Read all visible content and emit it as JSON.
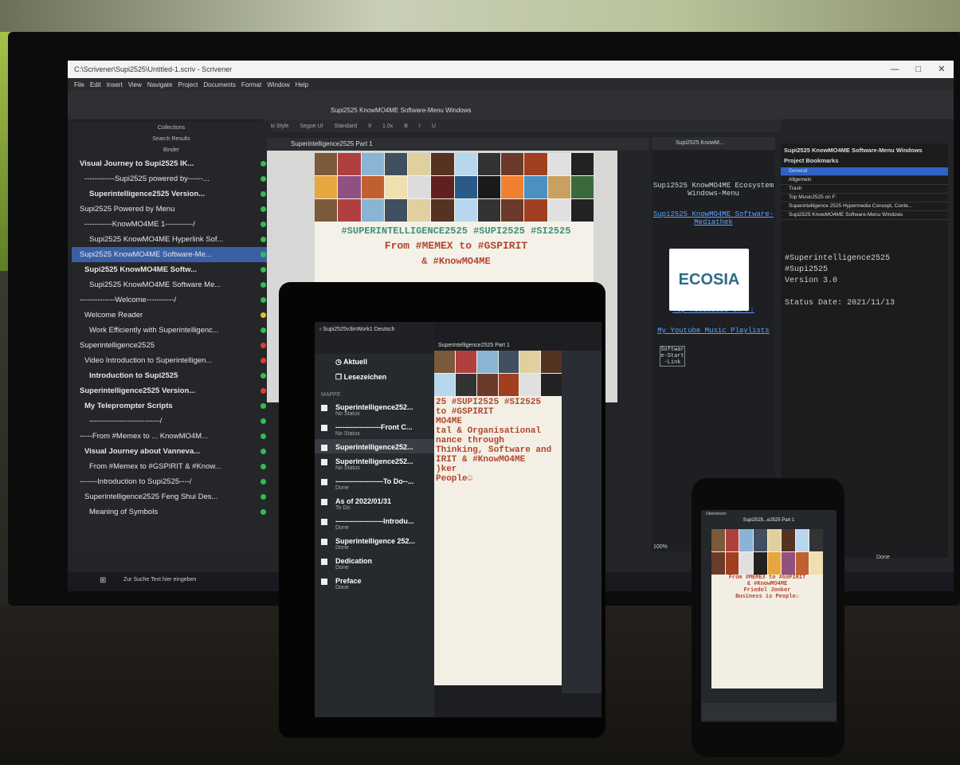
{
  "window": {
    "title_path": "C:\\Scrivener\\Supi2525\\Untitled-1.scriv - Scrivener",
    "controls": [
      "—",
      "□",
      "✕"
    ]
  },
  "menu": [
    "File",
    "Edit",
    "Insert",
    "View",
    "Navigate",
    "Project",
    "Documents",
    "Format",
    "Window",
    "Help"
  ],
  "toolbar": {
    "title": "Supi2525 KnowMO4ME Software-Menu Windows"
  },
  "format_bar": {
    "style": "No Style",
    "font": "Segoe UI",
    "weight": "Standard",
    "size": "9",
    "spacing": "1.0x"
  },
  "binder": {
    "header_collections": "Collections",
    "header_search": "Search Results",
    "header_binder": "Binder",
    "items": [
      {
        "label": "Visual Journey to Supi2525 IK...",
        "bold": true,
        "status": "green"
      },
      {
        "label": "------------Supi2525 powered by------...",
        "bold": false,
        "status": "green"
      },
      {
        "label": "Superintelligence2525 Version...",
        "bold": true,
        "status": "green"
      },
      {
        "label": "Supi2525 Powered by Menu",
        "bold": false,
        "status": "green"
      },
      {
        "label": "-----------KnowMO4ME 1-----------/",
        "bold": false,
        "status": "green"
      },
      {
        "label": "Supi2525 KnowMO4ME Hyperlink Sof...",
        "bold": false,
        "status": "green"
      },
      {
        "label": "Supi2525 KnowMO4ME Software-Me...",
        "bold": false,
        "status": "green",
        "selected": true
      },
      {
        "label": "Supi2525 KnowMO4ME Softw...",
        "bold": true,
        "status": "green"
      },
      {
        "label": "Supi2525 KnowMO4ME Software Me...",
        "bold": false,
        "status": "green"
      },
      {
        "label": "--------------Welcome-----------/",
        "bold": false,
        "status": "green"
      },
      {
        "label": "Welcome Reader",
        "bold": false,
        "status": "yellow"
      },
      {
        "label": "Work Efficiently with Superintelligenc...",
        "bold": false,
        "status": "green"
      },
      {
        "label": "Superintelligence2525",
        "bold": false,
        "status": "red"
      },
      {
        "label": "Video Introduction to Superintelligen...",
        "bold": false,
        "status": "red"
      },
      {
        "label": "Introduction to Supi2525",
        "bold": true,
        "status": "green"
      },
      {
        "label": "Superintelligence2525 Version...",
        "bold": true,
        "status": "red"
      },
      {
        "label": "My Teleprompter Scripts",
        "bold": true,
        "status": "green"
      },
      {
        "label": "----------------------------/",
        "bold": false,
        "status": "green"
      },
      {
        "label": "-----From #Memex to ... KnowMO4M...",
        "bold": false,
        "status": "green"
      },
      {
        "label": "Visual Journey about Vanneva...",
        "bold": true,
        "status": "green"
      },
      {
        "label": "From #Memex to #GSPIRIT & #Know...",
        "bold": false,
        "status": "green"
      },
      {
        "label": "-------Introduction to Supi2525----/",
        "bold": false,
        "status": "green"
      },
      {
        "label": "Superintelligence2525 Feng Shui Des...",
        "bold": false,
        "status": "green"
      },
      {
        "label": "Meaning of Symbols",
        "bold": false,
        "status": "green"
      }
    ]
  },
  "editor": {
    "tab": "Superintelligence2525 Part 1",
    "hashtags": "#SUPERINTELLIGENCE2525 #SUPI2525 #SI2525",
    "line2": "From #MEMEX to #GSPIRIT",
    "line3": "& #KnowMO4ME"
  },
  "inspector": {
    "tab": "Supi2525 KnowM...",
    "title": "Supi2525 KnowMO4ME Ecosystem Windows-Menu",
    "link1": "Supi2525 KnowMO4ME Software-Mediathek",
    "ecosia": "ECOSIA",
    "link2": "Top Music2525 on F:",
    "link3": "My Youtube Music Playlists",
    "button": "Software-Start-Link",
    "zoom": "100%"
  },
  "bookmarks": {
    "window_title": "Supi2525 KnowMO4ME Software-Menu Windows",
    "heading": "Project Bookmarks",
    "items": [
      "General",
      "Allgemein",
      "Trash",
      "Top Music2525 on F:",
      "Superintelligence 2525 Hypermedia Concept, Conte...",
      "Supi2525 KnowMO4ME Software-Menu Windows"
    ],
    "status": [
      "#Superintelligence2525",
      "#Supi2525",
      "Version 3.0",
      "",
      "Status Date: 2021/11/13"
    ],
    "done": "Done"
  },
  "taskbar": {
    "search": "Zur Suche Text hier eingeben"
  },
  "tablet": {
    "path": "Supi2525v3inWork1 Deutsch",
    "doc_title": "Superintelligence2525 Part 1",
    "menu": [
      "Aktuell",
      "Lesezeichen"
    ],
    "section": "MAPPE",
    "items": [
      {
        "title": "Superintelligence252...",
        "sub": "No Status"
      },
      {
        "title": "-------------------Front C...",
        "sub": "No Status"
      },
      {
        "title": "Superintelligence252...",
        "sub": "",
        "selected": true
      },
      {
        "title": "Superintelligence252...",
        "sub": "No Status"
      },
      {
        "title": "--------------------To Do--...",
        "sub": "Done"
      },
      {
        "title": "As of 2022/01/31",
        "sub": "To Do"
      },
      {
        "title": "--------------------Introdu...",
        "sub": "Done"
      },
      {
        "title": "Superintelligence 252...",
        "sub": "Done"
      },
      {
        "title": "Dedication",
        "sub": "Done"
      },
      {
        "title": "Preface",
        "sub": "Done"
      }
    ],
    "page_text": [
      "25 #SUPI2525 #SI2525",
      "to #GSPIRIT",
      "MO4ME",
      "tal & Organisational",
      "nance through",
      "Thinking, Software and",
      "IRIT & #KnowMO4ME",
      ")ker",
      "People☺"
    ]
  },
  "phone": {
    "status_left": "Ubersetzen",
    "title": "Supi2525...e2525 Part 1",
    "page_text": [
      "From #MEMEX to #GSPIRIT",
      "& #KnowMO4ME",
      "Friedel Jonker",
      "Business is People☺"
    ]
  },
  "collage_colors": [
    "#7a5a3a",
    "#333",
    "#c06030",
    "#4a90c0",
    "#e0d0a0",
    "#222",
    "#2a5a8a",
    "#b04040",
    "#6a3a2a",
    "#f0e0b0",
    "#c9a060",
    "#553322",
    "#e6a640",
    "#1a1a1a",
    "#8ab4d4",
    "#a04020",
    "#dcdcdc",
    "#3a6a3a",
    "#b7d7ef",
    "#905080",
    "#f08030",
    "#405060",
    "#e0e0e0",
    "#602020"
  ]
}
